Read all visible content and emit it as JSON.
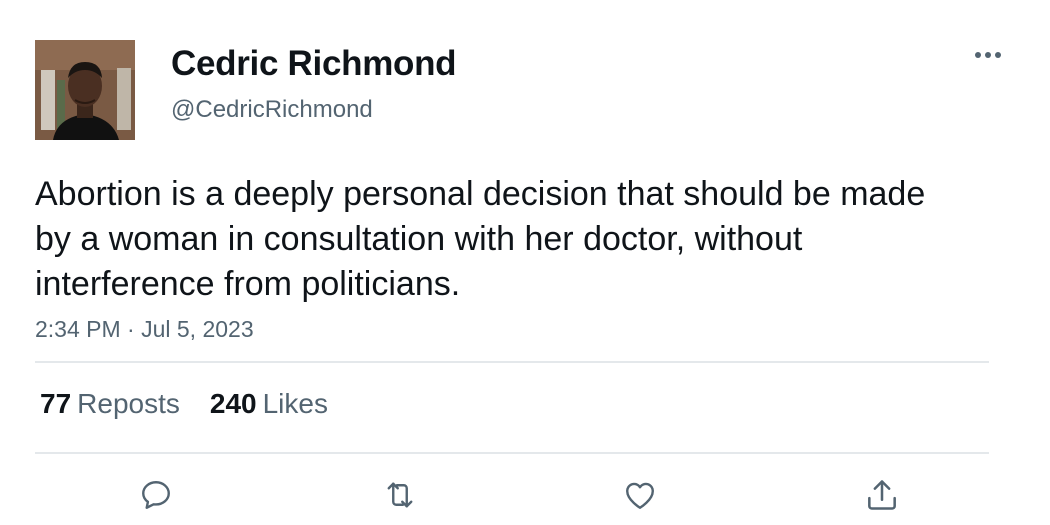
{
  "author": {
    "display_name": "Cedric Richmond",
    "handle": "@CedricRichmond"
  },
  "tweet": {
    "text": "Abortion is a deeply personal decision that should be made by a woman in consultation with her doctor, without interference from politicians.",
    "timestamp": "2:34 PM · Jul 5, 2023"
  },
  "stats": {
    "reposts_count": "77",
    "reposts_label": "Reposts",
    "likes_count": "240",
    "likes_label": "Likes"
  },
  "icons": {
    "more": "more-icon",
    "reply": "reply-icon",
    "repost": "repost-icon",
    "like": "heart-icon",
    "share": "share-icon"
  },
  "colors": {
    "text": "#0f1419",
    "secondary": "#536471",
    "divider": "#e4e8eb"
  }
}
